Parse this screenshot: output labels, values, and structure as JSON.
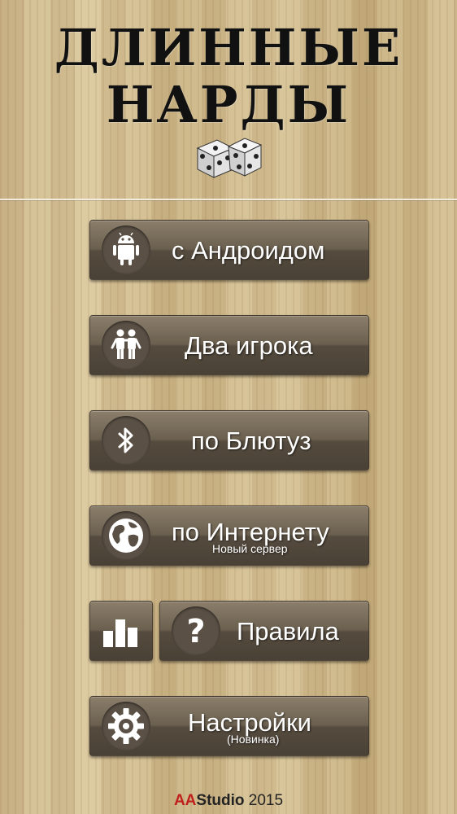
{
  "title": {
    "line1": "ДЛИННЫЕ",
    "line2": "НАРДЫ"
  },
  "menu": {
    "android": "с Андроидом",
    "two_players": "Два игрока",
    "bluetooth": "по Блютуз",
    "internet": "по Интернету",
    "internet_sub": "Новый сервер",
    "rules": "Правила",
    "settings": "Настройки",
    "settings_sub": "(Новинка)"
  },
  "icons": {
    "android": "android-icon",
    "two_players": "two-players-icon",
    "bluetooth": "bluetooth-icon",
    "internet": "globe-icon",
    "stats": "bar-chart-icon",
    "rules": "question-icon",
    "settings": "gear-icon"
  },
  "footer": {
    "aa": "AA",
    "studio": "Studio",
    "year": "2015"
  },
  "colors": {
    "button": "#5e5446",
    "footer_accent": "#c0201c",
    "text": "#ffffff"
  }
}
